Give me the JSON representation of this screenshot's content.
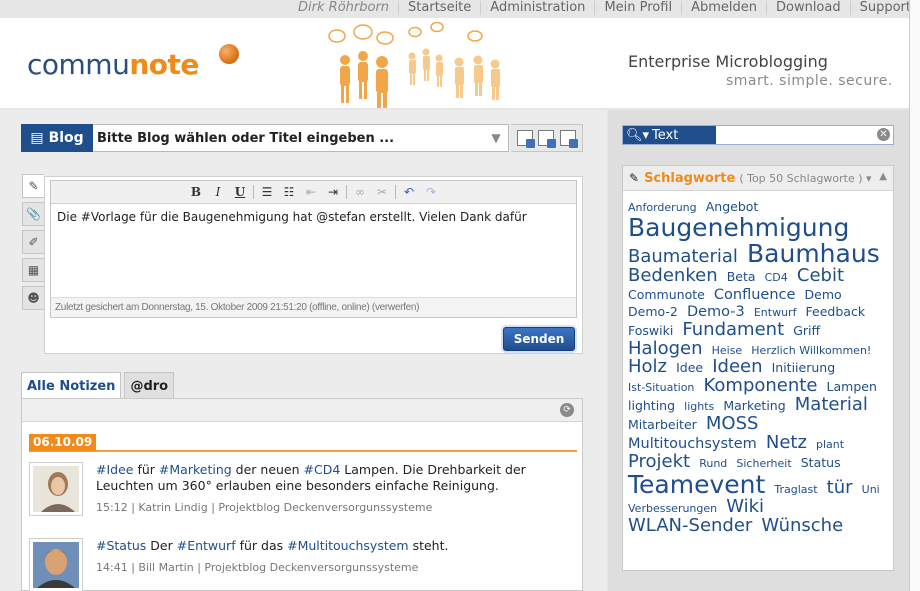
{
  "topnav": {
    "user": "Dirk Röhrborn",
    "links": [
      "Startseite",
      "Administration",
      "Mein Profil",
      "Abmelden",
      "Download",
      "Support"
    ]
  },
  "header": {
    "logo_part1": "commu",
    "logo_part2": "note",
    "tagline_main": "Enterprise Microblogging",
    "tagline_sub": "smart. simple. secure."
  },
  "blogbar": {
    "button_label": "Blog",
    "placeholder": "Bitte Blog wählen oder Titel eingeben ..."
  },
  "editor": {
    "toolbar": [
      "B",
      "I",
      "U"
    ],
    "text": "Die #Vorlage für die Baugenehmigung hat @stefan erstellt. Vielen Dank dafür",
    "status": "Zuletzt gesichert am Donnerstag, 15. Oktober 2009 21:51:20 (offline, online) (verwerfen)",
    "send_label": "Senden"
  },
  "feed": {
    "tabs": [
      "Alle Notizen",
      "@dro"
    ],
    "date": "06.10.09",
    "posts": [
      {
        "segments": [
          {
            "text": "#Idee",
            "tag": true
          },
          {
            "text": " für ",
            "tag": false
          },
          {
            "text": "#Marketing",
            "tag": true
          },
          {
            "text": " der neuen ",
            "tag": false
          },
          {
            "text": "#CD4",
            "tag": true
          },
          {
            "text": " Lampen. Die Drehbarkeit der Leuchten um 360° erlauben eine besonders einfache Reinigung.",
            "tag": false
          }
        ],
        "meta": "15:12 | Katrin Lindig | Projektblog Deckenversorgunssysteme"
      },
      {
        "segments": [
          {
            "text": "#Status",
            "tag": true
          },
          {
            "text": " Der ",
            "tag": false
          },
          {
            "text": "#Entwurf",
            "tag": true
          },
          {
            "text": " für das ",
            "tag": false
          },
          {
            "text": "#Multitouchsystem",
            "tag": true
          },
          {
            "text": " steht.",
            "tag": false
          }
        ],
        "meta": "14:41 | Bill Martin | Projektblog Deckenversorgunssysteme"
      }
    ]
  },
  "search": {
    "button_label": "Text",
    "value": ""
  },
  "tagcloud": {
    "title": "Schlagworte",
    "subtitle": "( Top 50 Schlagworte )",
    "tags": [
      {
        "t": "Anforderung",
        "s": 0
      },
      {
        "t": "Angebot",
        "s": 1
      },
      {
        "t": "Baugenehmigung",
        "s": 4
      },
      {
        "t": "Baumaterial",
        "s": 3
      },
      {
        "t": "Baumhaus",
        "s": 4
      },
      {
        "t": "Bedenken",
        "s": 3
      },
      {
        "t": "Beta",
        "s": 1
      },
      {
        "t": "CD4",
        "s": 0
      },
      {
        "t": "Cebit",
        "s": 3
      },
      {
        "t": "Communote",
        "s": 1
      },
      {
        "t": "Confluence",
        "s": 2
      },
      {
        "t": "Demo",
        "s": 1
      },
      {
        "t": "Demo-2",
        "s": 1
      },
      {
        "t": "Demo-3",
        "s": 2
      },
      {
        "t": "Entwurf",
        "s": 0
      },
      {
        "t": "Feedback",
        "s": 1
      },
      {
        "t": "Foswiki",
        "s": 1
      },
      {
        "t": "Fundament",
        "s": 3
      },
      {
        "t": "Griff",
        "s": 1
      },
      {
        "t": "Halogen",
        "s": 3
      },
      {
        "t": "Heise",
        "s": 0
      },
      {
        "t": "Herzlich Willkommen!",
        "s": 0
      },
      {
        "t": "Holz",
        "s": 3
      },
      {
        "t": "Idee",
        "s": 1
      },
      {
        "t": "Ideen",
        "s": 3
      },
      {
        "t": "Initiierung",
        "s": 1
      },
      {
        "t": "Ist-Situation",
        "s": 0
      },
      {
        "t": "Komponente",
        "s": 3
      },
      {
        "t": "Lampen",
        "s": 1
      },
      {
        "t": "lighting",
        "s": 1
      },
      {
        "t": "lights",
        "s": 0
      },
      {
        "t": "Marketing",
        "s": 1
      },
      {
        "t": "Material",
        "s": 3
      },
      {
        "t": "Mitarbeiter",
        "s": 1
      },
      {
        "t": "MOSS",
        "s": 3
      },
      {
        "t": "Multitouchsystem",
        "s": 2
      },
      {
        "t": "Netz",
        "s": 3
      },
      {
        "t": "plant",
        "s": 0
      },
      {
        "t": "Projekt",
        "s": 3
      },
      {
        "t": "Rund",
        "s": 0
      },
      {
        "t": "Sicherheit",
        "s": 0
      },
      {
        "t": "Status",
        "s": 1
      },
      {
        "t": "Teamevent",
        "s": 4
      },
      {
        "t": "Traglast",
        "s": 0
      },
      {
        "t": "tür",
        "s": 3
      },
      {
        "t": "Uni",
        "s": 0
      },
      {
        "t": "Verbesserungen",
        "s": 0
      },
      {
        "t": "Wiki",
        "s": 3
      },
      {
        "t": "WLAN-Sender",
        "s": 3
      },
      {
        "t": "Wünsche",
        "s": 3
      }
    ]
  },
  "colors": {
    "brand_blue": "#1f4e8c",
    "brand_orange": "#f08a1a"
  }
}
